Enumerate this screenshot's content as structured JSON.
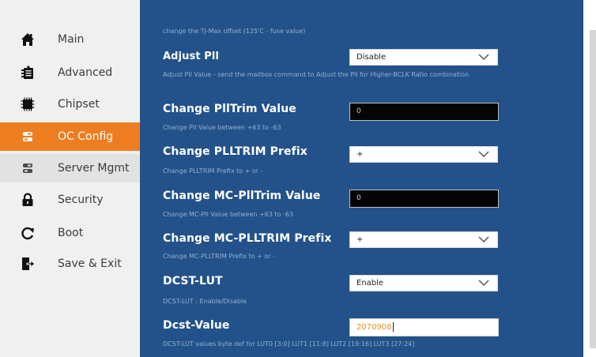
{
  "sidebar": {
    "items": [
      {
        "label": "Main",
        "icon": "home-icon"
      },
      {
        "label": "Advanced",
        "icon": "advanced-icon"
      },
      {
        "label": "Chipset",
        "icon": "chip-icon"
      },
      {
        "label": "OC Config",
        "icon": "oc-config-icon",
        "active": true
      },
      {
        "label": "Server Mgmt",
        "icon": "server-icon"
      },
      {
        "label": "Security",
        "icon": "lock-icon"
      },
      {
        "label": "Boot",
        "icon": "refresh-icon"
      },
      {
        "label": "Save & Exit",
        "icon": "exit-icon"
      }
    ]
  },
  "main": {
    "top_help": "change the TJ-Max offset (125'C - fuse value)",
    "settings": [
      {
        "label": "Adjust Pll",
        "control": "select",
        "value": "Disable",
        "help": "Adjust Pll Value - send the mailbox command to Adjust the Pll for Higher-BCLK Ratio combination"
      },
      {
        "label": "Change PllTrim Value",
        "control": "text",
        "value": "0",
        "help": "Change Pll Value between +63 to -63"
      },
      {
        "label": "Change PLLTRIM Prefix",
        "control": "select",
        "value": "+",
        "help": "Change PLLTRIM Prefix to + or -"
      },
      {
        "label": "Change MC-PllTrim Value",
        "control": "text",
        "value": "0",
        "help": "Change MC-Pll Value between +63 to -63"
      },
      {
        "label": "Change MC-PLLTRIM Prefix",
        "control": "select",
        "value": "+",
        "help": "Change MC-PLLTRIM Prefix to + or -"
      },
      {
        "label": "DCST-LUT",
        "control": "select",
        "value": "Enable",
        "help": "DCST-LUT : Enable/Disable"
      },
      {
        "label": "Dcst-Value",
        "control": "text",
        "value": "2070908",
        "help": "DCST-LUT values byte def for LUT0 [3:0] LUT1 [11:8] LUT2 [19:16] LUT3 [27:24]"
      }
    ]
  },
  "colors": {
    "accent": "#ee7d22",
    "panel": "#23528a",
    "help_text": "#93afd2"
  }
}
